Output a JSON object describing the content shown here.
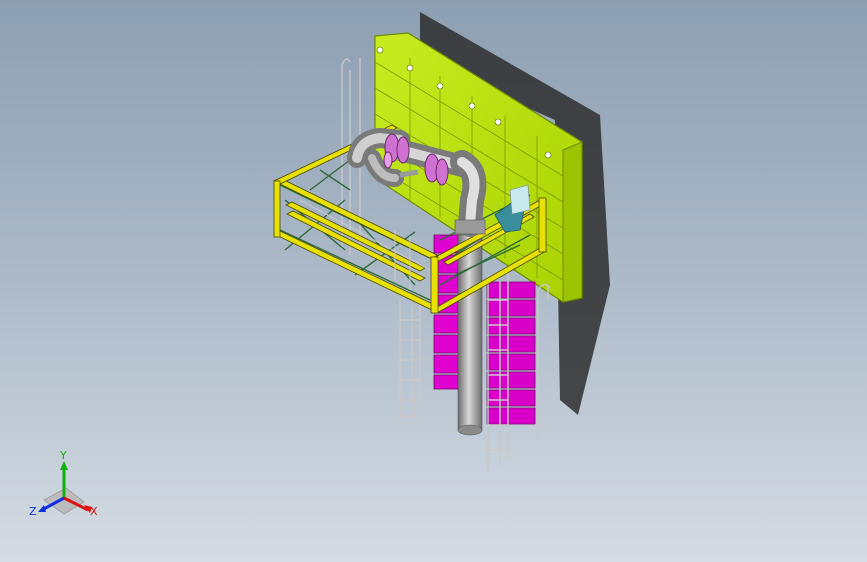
{
  "viewport": {
    "background_top": "#8d9fb2",
    "background_bottom": "#d4dce4"
  },
  "model": {
    "colors": {
      "backplate": "#b8e000",
      "backplate_edge": "#6f8a00",
      "frame": "#e8e000",
      "frame_edge": "#4a4a00",
      "brace": "#2e6b3a",
      "pipe": "#a9a9a9",
      "pipe_dark": "#6d6d6d",
      "flange": "#d070d0",
      "magenta_units": "#d800c8",
      "ladder": "#c9c9c9",
      "shadow": "#2e2e2e"
    }
  },
  "triad": {
    "x_label": "X",
    "y_label": "Y",
    "z_label": "Z",
    "x_color": "#e01010",
    "y_color": "#10b010",
    "z_color": "#1030e0"
  }
}
